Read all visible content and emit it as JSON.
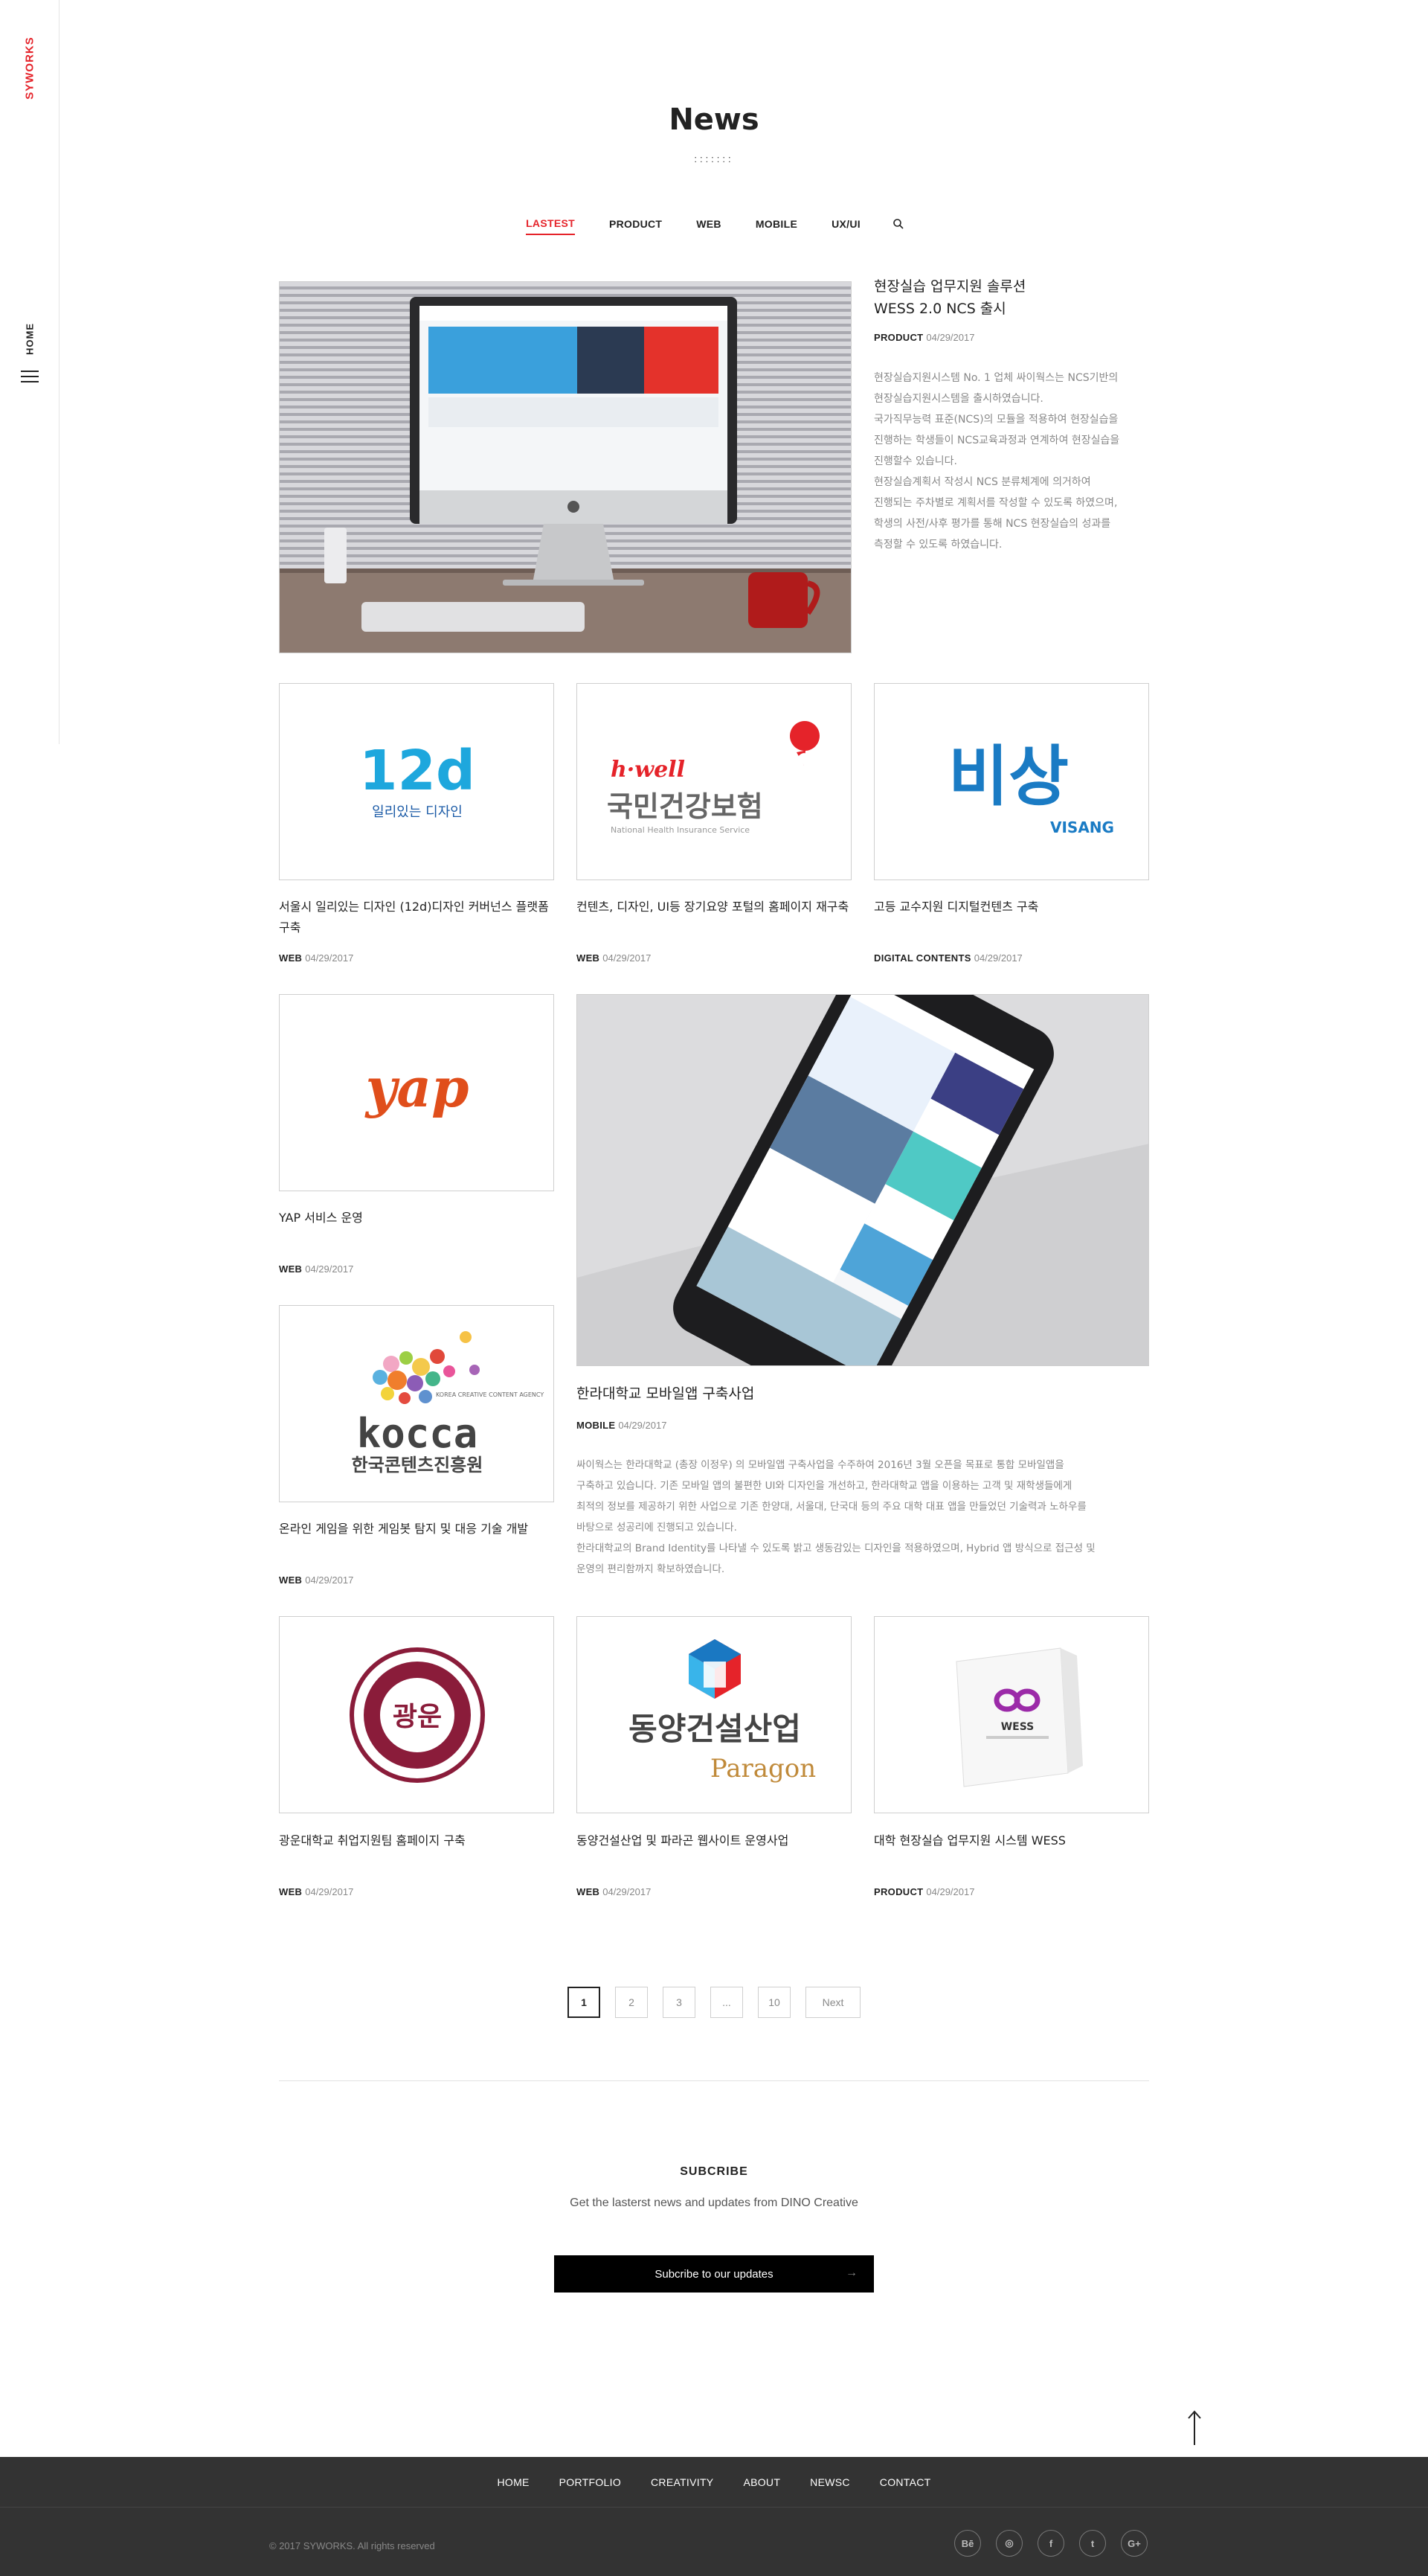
{
  "brand": {
    "logo_text": "SYWORKS",
    "home_label": "HOME"
  },
  "header": {
    "title": "News",
    "dots": ":::::::"
  },
  "tabs": [
    {
      "label": "LASTEST",
      "active": true
    },
    {
      "label": "PRODUCT"
    },
    {
      "label": "WEB"
    },
    {
      "label": "MOBILE"
    },
    {
      "label": "UX/UI"
    }
  ],
  "featured": {
    "title": "현장실습 업무지원 솔루션\nWESS 2.0 NCS 출시",
    "category": "PRODUCT",
    "date": "04/29/2017",
    "description": "현장실습지원시스템 No. 1 업체 싸이웍스는 NCS기반의\n현장실습지원시스템을 출시하였습니다.\n국가직무능력 표준(NCS)의 모듈을 적용하여 현장실습을\n진행하는 학생들이 NCS교육과정과 연계하여 현장실습을\n진행할수 있습니다.\n현장실습계획서 작성시 NCS 분류체계에 의거하여\n진행되는 주차별로 계획서를 작성할 수 있도록 하였으며,\n학생의 사전/사후 평가를 통해 NCS 현장실습의 성과를\n측정할 수 있도록 하였습니다."
  },
  "items": [
    {
      "title": "서울시 일리있는 디자인 (12d)디자인 커버넌스 플랫폼\n구축",
      "category": "WEB",
      "date": "04/29/2017",
      "logo_main": "12d",
      "logo_sub": "일리있는 디자인"
    },
    {
      "title": "컨텐츠, 디자인, UI등 장기요양 포털의 홈페이지 재구축",
      "category": "WEB",
      "date": "04/29/2017",
      "logo_brand": "h·well",
      "logo_main": "국민건강보험",
      "logo_sub": "National Health Insurance Service"
    },
    {
      "title": "고등 교수지원 디지털컨텐츠 구축",
      "category": "DIGITAL CONTENTS",
      "date": "04/29/2017",
      "logo_main": "비상",
      "logo_sub": "VISANG"
    },
    {
      "title": "YAP 서비스 운영",
      "category": "WEB",
      "date": "04/29/2017",
      "logo_main": "yap"
    },
    {
      "title": "온라인 게임을 위한 게임봇 탐지 및 대응 기술 개발",
      "category": "WEB",
      "date": "04/29/2017",
      "logo_small": "KOREA\nCREATIVE CONTENT\nAGENCY",
      "logo_main": "kocca",
      "logo_sub": "한국콘텐츠진흥원"
    },
    {
      "title": "광운대학교 취업지원팀 홈페이지 구축",
      "category": "WEB",
      "date": "04/29/2017",
      "logo_main": "광운"
    },
    {
      "title": "동양건설산업 및 파라곤 웹사이트 운영사업",
      "category": "WEB",
      "date": "04/29/2017",
      "logo_main": "동양건설산업",
      "logo_sub": "Paragon"
    },
    {
      "title": "대학 현장실습 업무지원 시스템 WESS",
      "category": "PRODUCT",
      "date": "04/29/2017",
      "logo_main": "WESS"
    }
  ],
  "mobile_feature": {
    "title": "한라대학교 모바일앱 구축사업",
    "category": "MOBILE",
    "date": "04/29/2017",
    "description": "싸이웍스는 한라대학교 (총장 이정우) 의 모바일앱 구축사업을 수주하여 2016년 3월 오픈을 목표로 통합 모바일앱을\n구축하고 있습니다. 기존 모바일 앱의 불편한 UI와 디자인을 개선하고, 한라대학교 앱을 이용하는 고객 및 재학생들에게\n최적의 정보를 제공하기 위한 사업으로 기존 한양대, 서울대, 단국대 등의 주요 대학 대표 앱을 만들었던 기술력과 노하우를\n바탕으로 성공리에 진행되고 있습니다.\n한라대학교의 Brand Identity를 나타낼 수 있도록 밝고 생동감있는 디자인을 적용하였으며, Hybrid 앱 방식으로 접근성 및\n운영의 편리함까지 확보하였습니다."
  },
  "pagination": {
    "pages": [
      "1",
      "2",
      "3",
      "...",
      "10"
    ],
    "active": "1",
    "next": "Next"
  },
  "subscribe": {
    "title": "SUBCRIBE",
    "text": "Get the lasterst news and updates from DINO Creative",
    "button": "Subcribe to our updates"
  },
  "footer": {
    "nav": [
      "HOME",
      "PORTFOLIO",
      "CREATIVITY",
      "ABOUT",
      "NEWSC",
      "CONTACT"
    ],
    "copyright": "© 2017 SYWORKS.  All rights reserved",
    "socials": [
      {
        "name": "behance-icon",
        "glyph": "Bē"
      },
      {
        "name": "dribbble-icon",
        "glyph": "◎"
      },
      {
        "name": "facebook-icon",
        "glyph": "f"
      },
      {
        "name": "twitter-icon",
        "glyph": "t"
      },
      {
        "name": "google-plus-icon",
        "glyph": "G+"
      }
    ]
  },
  "colors": {
    "accent": "#e5232a",
    "footer_bg": "#333333",
    "text": "#222222",
    "muted": "#888888"
  }
}
